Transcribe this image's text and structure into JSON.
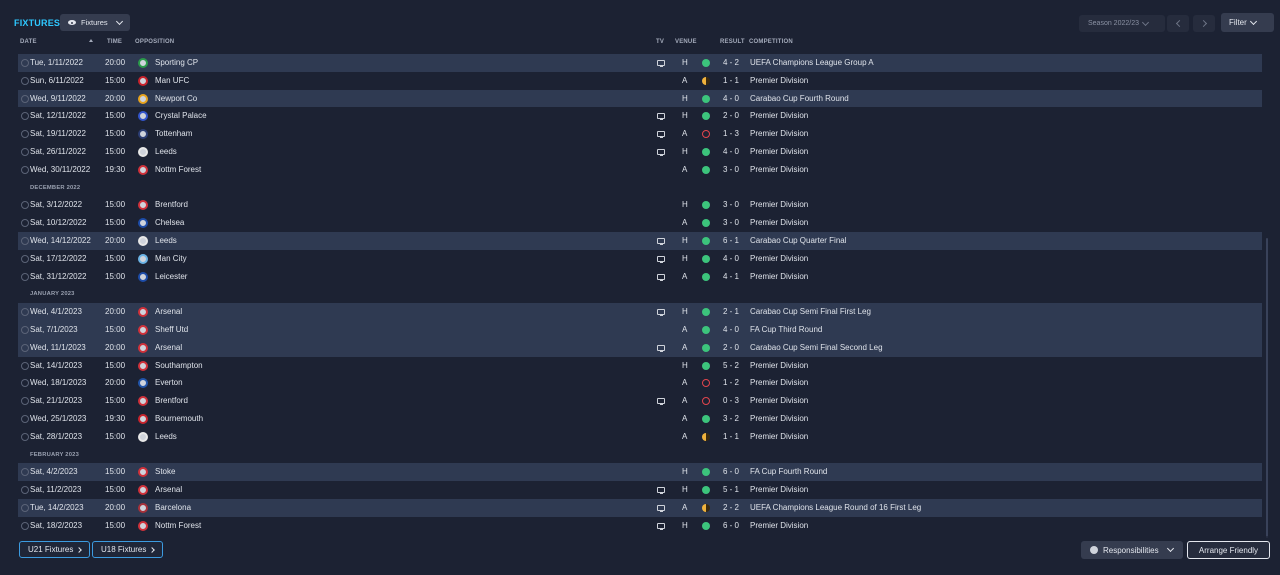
{
  "header": {
    "title": "FIXTURES",
    "view_label": "Fixtures",
    "season_label": "Season 2022/23",
    "filter_label": "Filter"
  },
  "columns": {
    "date": "DATE",
    "time": "TIME",
    "opposition": "OPPOSITION",
    "tv": "TV",
    "venue": "VENUE",
    "result": "RESULT",
    "competition": "COMPETITION"
  },
  "rows": [
    {
      "type": "fixture",
      "date": "Tue, 1/11/2022",
      "time": "20:00",
      "opp": "Sporting CP",
      "tv": true,
      "venue": "H",
      "outcome": "w",
      "score": "4 - 2",
      "comp": "UEFA Champions League Group A",
      "hl": true
    },
    {
      "type": "fixture",
      "date": "Sun, 6/11/2022",
      "time": "15:00",
      "opp": "Man UFC",
      "tv": false,
      "venue": "A",
      "outcome": "d",
      "score": "1 - 1",
      "comp": "Premier Division",
      "hl": false
    },
    {
      "type": "fixture",
      "date": "Wed, 9/11/2022",
      "time": "20:00",
      "opp": "Newport Co",
      "tv": false,
      "venue": "H",
      "outcome": "w",
      "score": "4 - 0",
      "comp": "Carabao Cup Fourth Round",
      "hl": true
    },
    {
      "type": "fixture",
      "date": "Sat, 12/11/2022",
      "time": "15:00",
      "opp": "Crystal Palace",
      "tv": true,
      "venue": "H",
      "outcome": "w",
      "score": "2 - 0",
      "comp": "Premier Division",
      "hl": false
    },
    {
      "type": "fixture",
      "date": "Sat, 19/11/2022",
      "time": "15:00",
      "opp": "Tottenham",
      "tv": true,
      "venue": "A",
      "outcome": "l",
      "score": "1 - 3",
      "comp": "Premier Division",
      "hl": false
    },
    {
      "type": "fixture",
      "date": "Sat, 26/11/2022",
      "time": "15:00",
      "opp": "Leeds",
      "tv": true,
      "venue": "H",
      "outcome": "w",
      "score": "4 - 0",
      "comp": "Premier Division",
      "hl": false
    },
    {
      "type": "fixture",
      "date": "Wed, 30/11/2022",
      "time": "19:30",
      "opp": "Nottm Forest",
      "tv": false,
      "venue": "A",
      "outcome": "w",
      "score": "3 - 0",
      "comp": "Premier Division",
      "hl": false
    },
    {
      "type": "month",
      "label": "DECEMBER 2022"
    },
    {
      "type": "fixture",
      "date": "Sat, 3/12/2022",
      "time": "15:00",
      "opp": "Brentford",
      "tv": false,
      "venue": "H",
      "outcome": "w",
      "score": "3 - 0",
      "comp": "Premier Division",
      "hl": false
    },
    {
      "type": "fixture",
      "date": "Sat, 10/12/2022",
      "time": "15:00",
      "opp": "Chelsea",
      "tv": false,
      "venue": "A",
      "outcome": "w",
      "score": "3 - 0",
      "comp": "Premier Division",
      "hl": false
    },
    {
      "type": "fixture",
      "date": "Wed, 14/12/2022",
      "time": "20:00",
      "opp": "Leeds",
      "tv": true,
      "venue": "H",
      "outcome": "w",
      "score": "6 - 1",
      "comp": "Carabao Cup Quarter Final",
      "hl": true
    },
    {
      "type": "fixture",
      "date": "Sat, 17/12/2022",
      "time": "15:00",
      "opp": "Man City",
      "tv": true,
      "venue": "H",
      "outcome": "w",
      "score": "4 - 0",
      "comp": "Premier Division",
      "hl": false
    },
    {
      "type": "fixture",
      "date": "Sat, 31/12/2022",
      "time": "15:00",
      "opp": "Leicester",
      "tv": true,
      "venue": "A",
      "outcome": "w",
      "score": "4 - 1",
      "comp": "Premier Division",
      "hl": false
    },
    {
      "type": "month",
      "label": "JANUARY 2023"
    },
    {
      "type": "fixture",
      "date": "Wed, 4/1/2023",
      "time": "20:00",
      "opp": "Arsenal",
      "tv": true,
      "venue": "H",
      "outcome": "w",
      "score": "2 - 1",
      "comp": "Carabao Cup Semi Final First Leg",
      "hl": true
    },
    {
      "type": "fixture",
      "date": "Sat, 7/1/2023",
      "time": "15:00",
      "opp": "Sheff Utd",
      "tv": false,
      "venue": "A",
      "outcome": "w",
      "score": "4 - 0",
      "comp": "FA Cup Third Round",
      "hl": true
    },
    {
      "type": "fixture",
      "date": "Wed, 11/1/2023",
      "time": "20:00",
      "opp": "Arsenal",
      "tv": true,
      "venue": "A",
      "outcome": "w",
      "score": "2 - 0",
      "comp": "Carabao Cup Semi Final Second Leg",
      "hl": true
    },
    {
      "type": "fixture",
      "date": "Sat, 14/1/2023",
      "time": "15:00",
      "opp": "Southampton",
      "tv": false,
      "venue": "H",
      "outcome": "w",
      "score": "5 - 2",
      "comp": "Premier Division",
      "hl": false
    },
    {
      "type": "fixture",
      "date": "Wed, 18/1/2023",
      "time": "20:00",
      "opp": "Everton",
      "tv": false,
      "venue": "A",
      "outcome": "l",
      "score": "1 - 2",
      "comp": "Premier Division",
      "hl": false
    },
    {
      "type": "fixture",
      "date": "Sat, 21/1/2023",
      "time": "15:00",
      "opp": "Brentford",
      "tv": true,
      "venue": "A",
      "outcome": "l",
      "score": "0 - 3",
      "comp": "Premier Division",
      "hl": false
    },
    {
      "type": "fixture",
      "date": "Wed, 25/1/2023",
      "time": "19:30",
      "opp": "Bournemouth",
      "tv": false,
      "venue": "A",
      "outcome": "w",
      "score": "3 - 2",
      "comp": "Premier Division",
      "hl": false
    },
    {
      "type": "fixture",
      "date": "Sat, 28/1/2023",
      "time": "15:00",
      "opp": "Leeds",
      "tv": false,
      "venue": "A",
      "outcome": "d",
      "score": "1 - 1",
      "comp": "Premier Division",
      "hl": false
    },
    {
      "type": "month",
      "label": "FEBRUARY 2023"
    },
    {
      "type": "fixture",
      "date": "Sat, 4/2/2023",
      "time": "15:00",
      "opp": "Stoke",
      "tv": false,
      "venue": "H",
      "outcome": "w",
      "score": "6 - 0",
      "comp": "FA Cup Fourth Round",
      "hl": true
    },
    {
      "type": "fixture",
      "date": "Sat, 11/2/2023",
      "time": "15:00",
      "opp": "Arsenal",
      "tv": true,
      "venue": "H",
      "outcome": "w",
      "score": "5 - 1",
      "comp": "Premier Division",
      "hl": false
    },
    {
      "type": "fixture",
      "date": "Tue, 14/2/2023",
      "time": "20:00",
      "opp": "Barcelona",
      "tv": true,
      "venue": "A",
      "outcome": "d",
      "score": "2 - 2",
      "comp": "UEFA Champions League Round of 16  First Leg",
      "hl": true
    },
    {
      "type": "fixture",
      "date": "Sat, 18/2/2023",
      "time": "15:00",
      "opp": "Nottm Forest",
      "tv": true,
      "venue": "H",
      "outcome": "w",
      "score": "6 - 0",
      "comp": "Premier Division",
      "hl": false
    }
  ],
  "crest_colors": {
    "Sporting CP": "#2a9a4a",
    "Man UFC": "#c8232c",
    "Newport Co": "#e8a31d",
    "Crystal Palace": "#3355cc",
    "Tottenham": "#2c3e74",
    "Leeds": "#e8e8e8",
    "Nottm Forest": "#d0313a",
    "Brentford": "#d0313a",
    "Chelsea": "#1d4ca8",
    "Man City": "#6cb4e6",
    "Leicester": "#1d4ca8",
    "Arsenal": "#d0313a",
    "Sheff Utd": "#d0313a",
    "Southampton": "#d0313a",
    "Everton": "#2154a8",
    "Bournemouth": "#c8232c",
    "Stoke": "#d0313a",
    "Barcelona": "#a8313a"
  },
  "footer": {
    "u21_label": "U21 Fixtures",
    "u18_label": "U18 Fixtures",
    "responsibilities_label": "Responsibilities",
    "arrange_label": "Arrange Friendly"
  }
}
